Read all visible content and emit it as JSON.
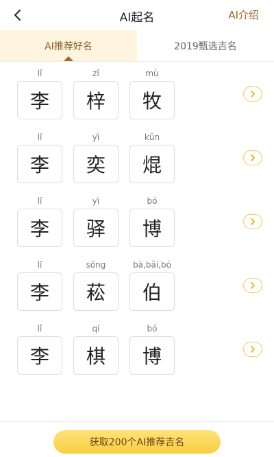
{
  "header": {
    "title": "AI起名",
    "right_link": "AI介绍"
  },
  "tabs": [
    {
      "label": "AI推荐好名",
      "active": true
    },
    {
      "label": "2019甄选吉名",
      "active": false
    }
  ],
  "names": [
    {
      "chars": [
        "李",
        "梓",
        "牧"
      ],
      "pinyin": [
        "lǐ",
        "zǐ",
        "mù"
      ]
    },
    {
      "chars": [
        "李",
        "奕",
        "焜"
      ],
      "pinyin": [
        "lǐ",
        "yì",
        "kūn"
      ]
    },
    {
      "chars": [
        "李",
        "驿",
        "博"
      ],
      "pinyin": [
        "lǐ",
        "yì",
        "bó"
      ]
    },
    {
      "chars": [
        "李",
        "菘",
        "伯"
      ],
      "pinyin": [
        "lǐ",
        "sōng",
        "bà,bǎi,bó"
      ]
    },
    {
      "chars": [
        "李",
        "棋",
        "博"
      ],
      "pinyin": [
        "lǐ",
        "qí",
        "bó"
      ]
    }
  ],
  "footer": {
    "cta_label": "获取200个AI推荐吉名"
  },
  "colors": {
    "accent_brown": "#a0621d",
    "tab_active_bg": "#fff4dd",
    "arrow_yellow": "#f2c94c",
    "cta_yellow": "#f9cf3f"
  }
}
